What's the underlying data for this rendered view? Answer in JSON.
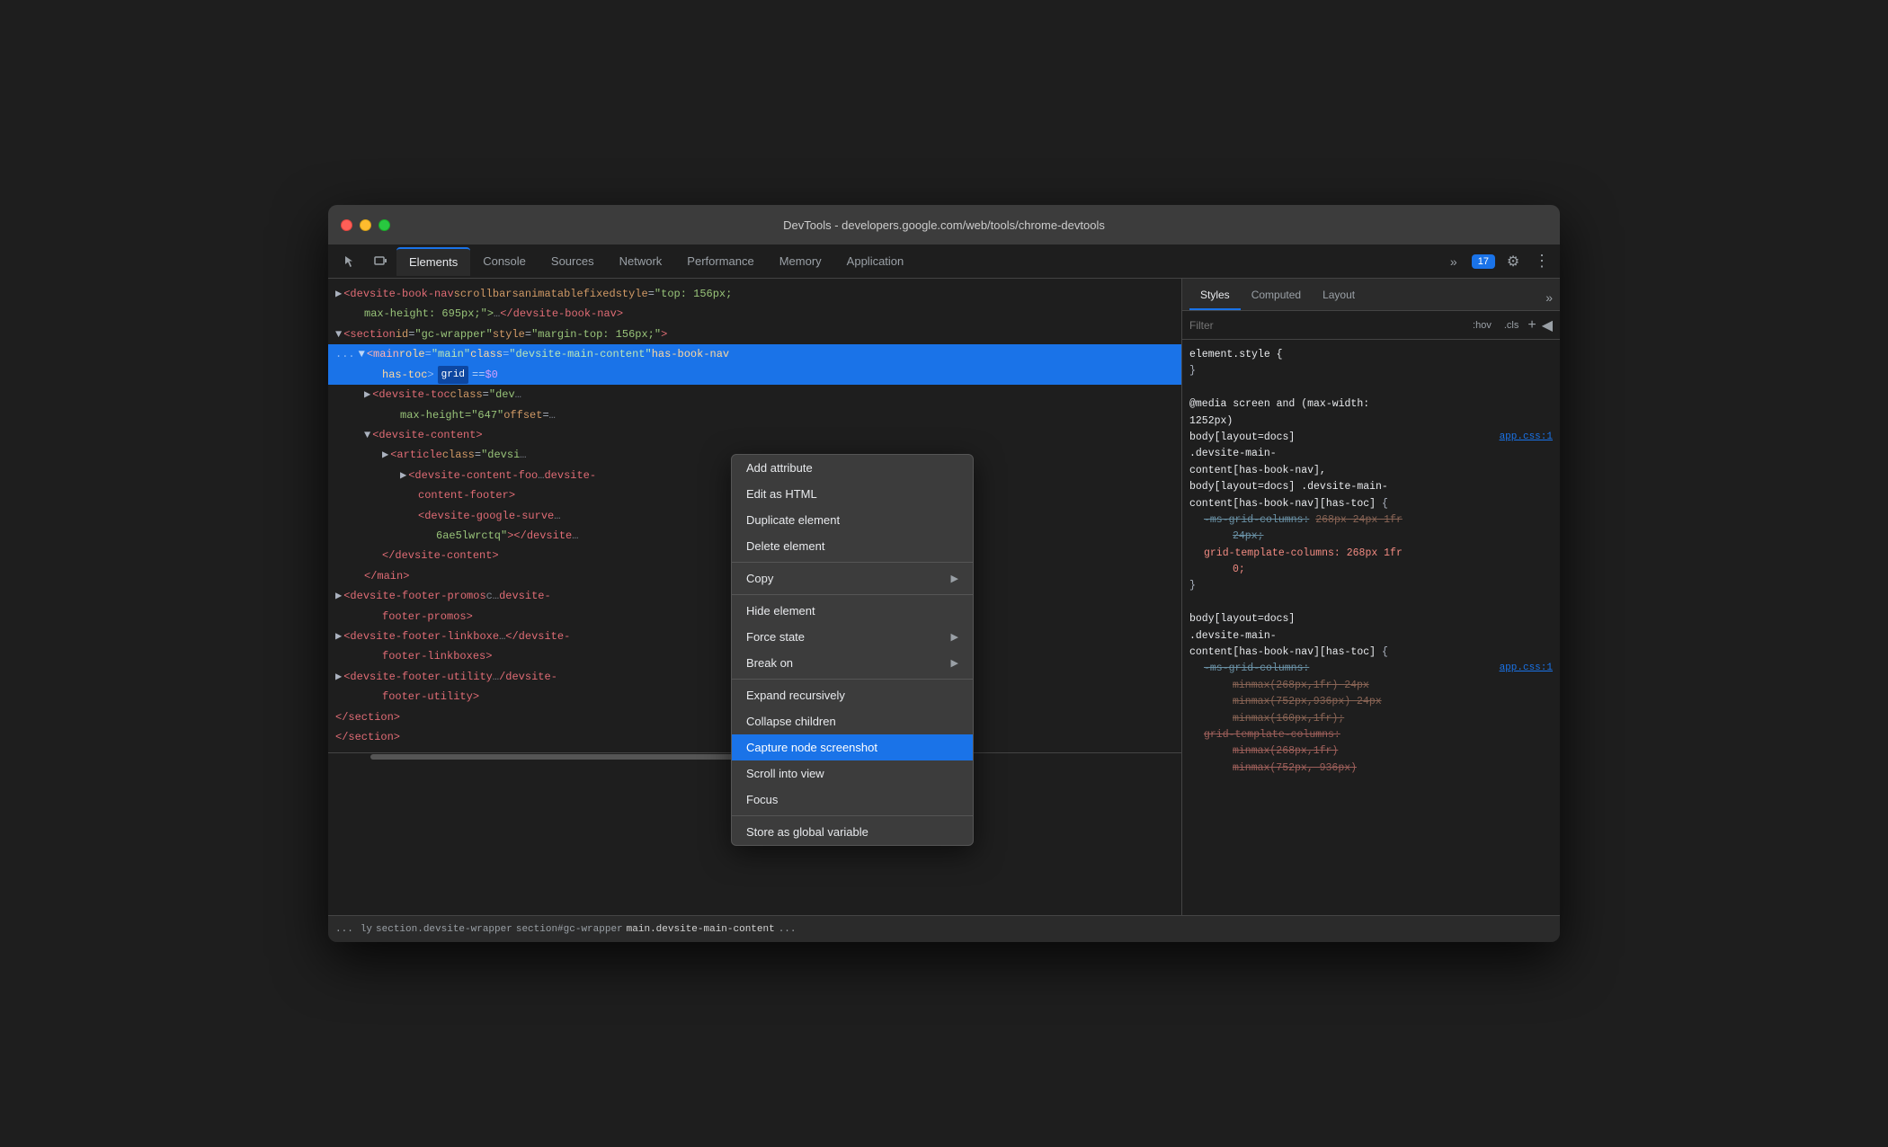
{
  "window": {
    "title": "DevTools - developers.google.com/web/tools/chrome-devtools"
  },
  "tabbar": {
    "cursor_icon": "⬡",
    "device_icon": "▭",
    "tabs": [
      {
        "label": "Elements",
        "active": true
      },
      {
        "label": "Console",
        "active": false
      },
      {
        "label": "Sources",
        "active": false
      },
      {
        "label": "Network",
        "active": false
      },
      {
        "label": "Performance",
        "active": false
      },
      {
        "label": "Memory",
        "active": false
      },
      {
        "label": "Application",
        "active": false
      }
    ],
    "more_label": "»",
    "badge": "17",
    "gear_icon": "⚙",
    "dots_icon": "⋮"
  },
  "dom": {
    "line1": "▶ <devsite-book-nav scrollbars animatable fixed style=\"top: 156px;",
    "line1b": "max-height: 695px;\">…</devsite-book-nav>",
    "line2": "▼ <section id=\"gc-wrapper\" style=\"margin-top: 156px;\">",
    "line3_prefix": "...",
    "line3": "▼ <main role=\"main\" class=\"devsite-main-content\" has-book-nav",
    "line3b": "has-toc>",
    "line3_grid": "grid",
    "line3_eq": "==",
    "line3_var": "$0",
    "line4": "▶ <devsite-toc class=\"dev",
    "line4b": "max-height=\"647\" offset=",
    "line5": "▼ <devsite-content>",
    "line6": "▶ <article class=\"devsi",
    "line7": "▶ <devsite-content-foo",
    "line8": "<devsite-google-surve",
    "line8b": "6ae5lwrctq\"></devsite",
    "line9": "</devsite-content>",
    "line10": "</main>",
    "line11": "▶ <devsite-footer-promos c",
    "line11b": "footer-promos>",
    "line12": "▶ <devsite-footer-linkboxe",
    "line12b": "footer-linkboxes>",
    "line13": "▶ <devsite-footer-utility",
    "line13b": "footer-utility>",
    "line14": "</section>",
    "line15": "</section>"
  },
  "styles_panel": {
    "tabs": [
      {
        "label": "Styles",
        "active": true
      },
      {
        "label": "Computed",
        "active": false
      },
      {
        "label": "Layout",
        "active": false
      }
    ],
    "more": "»",
    "filter_placeholder": "Filter",
    "hov_label": ":hov",
    "cls_label": ".cls",
    "element_style": "element.style {",
    "element_style_close": "}",
    "rules": [
      {
        "selector": "@media screen and (max-width: 1252px)",
        "source": "app.css:1",
        "body_selector": "body[layout=docs] .devsite-main-content[has-book-nav],",
        "body_selector2": "body[layout=docs] .devsite-main-content[has-book-nav][has-toc] {",
        "props": [
          {
            "name": "-ms-grid-columns:",
            "value": "268px 24px 1fr 24px;",
            "strikethrough": true,
            "indent": 2
          },
          {
            "name": "grid-template-columns:",
            "value": "268px 1fr 0;",
            "strikethrough": false,
            "red": true,
            "indent": 1
          }
        ]
      },
      {
        "selector": "body[layout=docs] .devsite-main-content[has-book-nav][has-toc] {",
        "source": "app.css:1",
        "props": [
          {
            "name": "-ms-grid-columns:",
            "value": "minmax(268px,1fr) 24px minmax(752px,936px) 24px minmax(160px,1fr);",
            "strikethrough": true,
            "indent": 2
          },
          {
            "name": "grid-template-columns:",
            "value": "minmax(268px,1fr) minmax(752px, 936px)",
            "strikethrough": true,
            "red": true,
            "indent": 2
          }
        ]
      }
    ]
  },
  "context_menu": {
    "items": [
      {
        "label": "Add attribute",
        "has_arrow": false
      },
      {
        "label": "Edit as HTML",
        "has_arrow": false
      },
      {
        "label": "Duplicate element",
        "has_arrow": false
      },
      {
        "label": "Delete element",
        "has_arrow": false
      },
      {
        "separator": true
      },
      {
        "label": "Copy",
        "has_arrow": true
      },
      {
        "separator": true
      },
      {
        "label": "Hide element",
        "has_arrow": false
      },
      {
        "label": "Force state",
        "has_arrow": true
      },
      {
        "label": "Break on",
        "has_arrow": true
      },
      {
        "separator": true
      },
      {
        "label": "Expand recursively",
        "has_arrow": false
      },
      {
        "label": "Collapse children",
        "has_arrow": false
      },
      {
        "label": "Capture node screenshot",
        "has_arrow": false,
        "highlighted": true
      },
      {
        "label": "Scroll into view",
        "has_arrow": false
      },
      {
        "label": "Focus",
        "has_arrow": false
      },
      {
        "separator": true
      },
      {
        "label": "Store as global variable",
        "has_arrow": false
      }
    ]
  },
  "breadcrumb": {
    "dots": "...",
    "items": [
      {
        "label": "ly",
        "active": false
      },
      {
        "label": "section.devsite-wrapper",
        "active": false
      },
      {
        "label": "section#gc-wrapper",
        "active": false
      },
      {
        "label": "main.devsite-main-content",
        "active": true
      }
    ],
    "ellipsis": "..."
  }
}
